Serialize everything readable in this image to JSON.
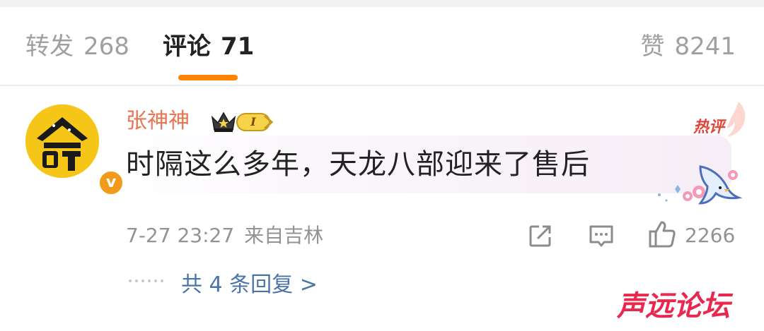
{
  "tabs": {
    "repost": {
      "label": "转发",
      "count": "268"
    },
    "comments": {
      "label": "评论",
      "count": "71"
    },
    "likes": {
      "label": "赞",
      "count": "8241"
    },
    "active": "comments"
  },
  "comment": {
    "username": "张神神",
    "level_badge": "I",
    "hot_badge": "热评",
    "text": "时隔这么多年，天龙八部迎来了售后",
    "date": "7-27 23:27",
    "location": "来自吉林",
    "like_count": "2266",
    "replies_link": "共 4 条回复 >",
    "verified_badge": "v",
    "icons": {
      "share": "share-icon",
      "reply": "comment-icon",
      "like": "thumbs-up-icon",
      "crown": "crown-icon",
      "hot_flame": "flame-icon",
      "sticker": "swallow-bird-sticker"
    }
  },
  "watermark": "声远论坛",
  "colors": {
    "tab_indicator": "#ff8200",
    "username": "#eb7350",
    "link": "#4a74a8",
    "hot_badge": "#e0453a",
    "watermark": "#e8284f",
    "avatar_bg": "#f5c518",
    "verified_badge": "#f29a1a"
  }
}
